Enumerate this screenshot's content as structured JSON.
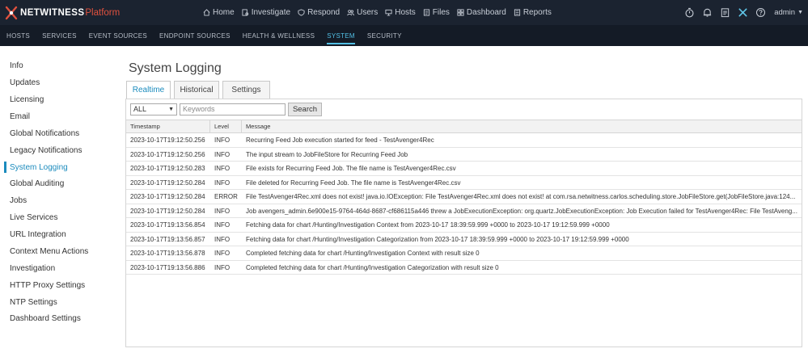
{
  "app": {
    "logo_text": "NETWITNESS",
    "logo_sub": "Platform"
  },
  "topnav": [
    {
      "label": "Home",
      "icon": "home-icon"
    },
    {
      "label": "Investigate",
      "icon": "investigate-icon"
    },
    {
      "label": "Respond",
      "icon": "shield-icon"
    },
    {
      "label": "Users",
      "icon": "users-icon"
    },
    {
      "label": "Hosts",
      "icon": "hosts-icon"
    },
    {
      "label": "Files",
      "icon": "files-icon"
    },
    {
      "label": "Dashboard",
      "icon": "dashboard-icon"
    },
    {
      "label": "Reports",
      "icon": "reports-icon"
    }
  ],
  "top_right": {
    "user": "admin"
  },
  "subnav": [
    "HOSTS",
    "SERVICES",
    "EVENT SOURCES",
    "ENDPOINT SOURCES",
    "HEALTH & WELLNESS",
    "SYSTEM",
    "SECURITY"
  ],
  "sidebar": [
    "Info",
    "Updates",
    "Licensing",
    "Email",
    "Global Notifications",
    "Legacy Notifications",
    "System Logging",
    "Global Auditing",
    "Jobs",
    "Live Services",
    "URL Integration",
    "Context Menu Actions",
    "Investigation",
    "HTTP Proxy Settings",
    "NTP Settings",
    "Dashboard Settings"
  ],
  "page": {
    "title": "System Logging"
  },
  "tabs": [
    "Realtime",
    "Historical",
    "Settings"
  ],
  "filter": {
    "level": "ALL",
    "keywords_placeholder": "Keywords",
    "search_label": "Search"
  },
  "table": {
    "headers": [
      "Timestamp",
      "Level",
      "Message"
    ],
    "rows": [
      [
        "2023-10-17T19:12:50.256",
        "INFO",
        "Recurring Feed Job execution started for feed - TestAvenger4Rec"
      ],
      [
        "2023-10-17T19:12:50.256",
        "INFO",
        "The input stream to JobFileStore for Recurring Feed Job"
      ],
      [
        "2023-10-17T19:12:50.283",
        "INFO",
        "File exists for Recurring Feed Job. The file name is TestAvenger4Rec.csv"
      ],
      [
        "2023-10-17T19:12:50.284",
        "INFO",
        "File deleted for Recurring Feed Job. The file name is TestAvenger4Rec.csv"
      ],
      [
        "2023-10-17T19:12:50.284",
        "ERROR",
        "File TestAvenger4Rec.xml does not exist! java.io.IOException: File TestAvenger4Rec.xml does not exist! at com.rsa.netwitness.carlos.scheduling.store.JobFileStore.get(JobFileStore.java:124..."
      ],
      [
        "2023-10-17T19:12:50.284",
        "INFO",
        "Job avengers_admin.6e900e15-9764-464d-8687-cf686115a446 threw a JobExecutionException: org.quartz.JobExecutionException: Job Execution failed for TestAvenger4Rec: File TestAveng..."
      ],
      [
        "2023-10-17T19:13:56.854",
        "INFO",
        "Fetching data for chart /Hunting/Investigation Context from 2023-10-17 18:39:59.999 +0000 to 2023-10-17 19:12:59.999 +0000"
      ],
      [
        "2023-10-17T19:13:56.857",
        "INFO",
        "Fetching data for chart /Hunting/Investigation Categorization from 2023-10-17 18:39:59.999 +0000 to 2023-10-17 19:12:59.999 +0000"
      ],
      [
        "2023-10-17T19:13:56.878",
        "INFO",
        "Completed fetching data for chart /Hunting/Investigation Context with result size 0"
      ],
      [
        "2023-10-17T19:13:56.886",
        "INFO",
        "Completed fetching data for chart /Hunting/Investigation Categorization with result size 0"
      ]
    ]
  },
  "colors": {
    "accent": "#1b8bbd",
    "topbar": "#1b2330",
    "brand_red": "#e0513e"
  }
}
